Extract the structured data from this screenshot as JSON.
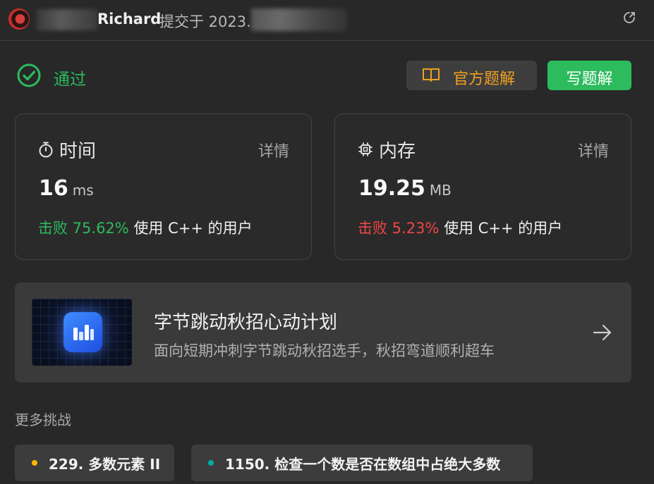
{
  "header": {
    "user": "Richard",
    "submitted_prefix": "提交于 2023.",
    "share_icon": "external-link-icon"
  },
  "status": {
    "text": "通过",
    "color": "#2cbb5d",
    "icon": "check-circle-icon"
  },
  "actions": {
    "official_solution": "官方题解",
    "write_solution": "写题解",
    "official_color": "#f0a020",
    "write_bg": "#2cbb5d"
  },
  "time_card": {
    "title": "时间",
    "detail": "详情",
    "value": "16",
    "unit": "ms",
    "beat_label": "击败 75.62%",
    "beat_suffix": "使用 C++ 的用户",
    "icon": "stopwatch-icon"
  },
  "memory_card": {
    "title": "内存",
    "detail": "详情",
    "value": "19.25",
    "unit": "MB",
    "beat_label": "击败 5.23%",
    "beat_suffix": "使用 C++ 的用户",
    "icon": "chip-icon"
  },
  "banner": {
    "title": "字节跳动秋招心动计划",
    "subtitle": "面向短期冲刺字节跳动秋招选手，秋招弯道顺利超车",
    "icon": "arrow-right-icon"
  },
  "more": {
    "title": "更多挑战",
    "items": [
      {
        "label": "229. 多数元素 II",
        "dot_color": "#ffb800"
      },
      {
        "label": "1150. 检查一个数是否在数组中占绝大多数",
        "dot_color": "#00af9b"
      }
    ]
  }
}
